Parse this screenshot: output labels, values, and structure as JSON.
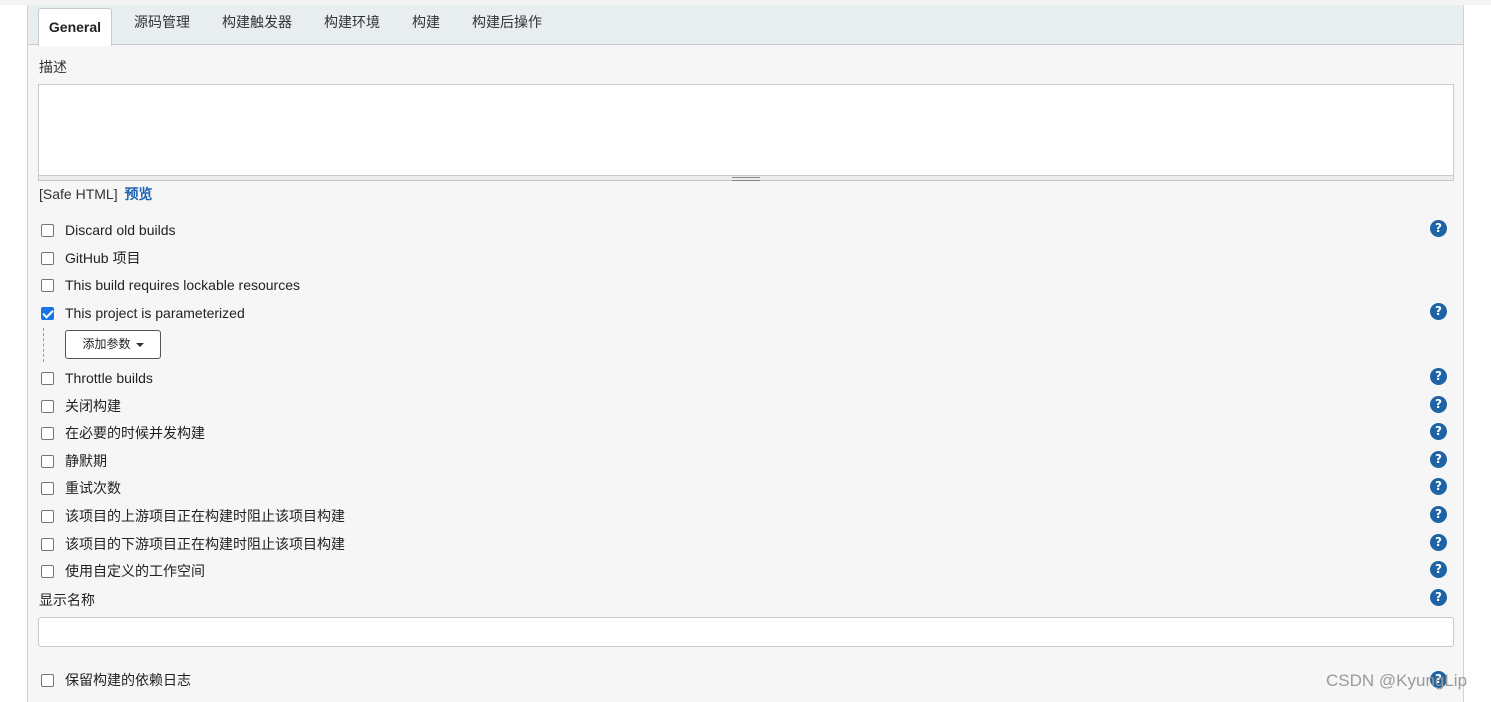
{
  "tabs": [
    "General",
    "源码管理",
    "构建触发器",
    "构建环境",
    "构建",
    "构建后操作"
  ],
  "description": {
    "label": "描述",
    "value": "",
    "safe_html": "[Safe HTML]",
    "preview_link": "预览"
  },
  "options": [
    {
      "label": "Discard old builds",
      "checked": false,
      "help": true
    },
    {
      "label": "GitHub 项目",
      "checked": false,
      "help": false
    },
    {
      "label": "This build requires lockable resources",
      "checked": false,
      "help": false
    },
    {
      "label": "This project is parameterized",
      "checked": true,
      "help": true
    },
    {
      "label": "Throttle builds",
      "checked": false,
      "help": true
    },
    {
      "label": "关闭构建",
      "checked": false,
      "help": true
    },
    {
      "label": "在必要的时候并发构建",
      "checked": false,
      "help": true
    },
    {
      "label": "静默期",
      "checked": false,
      "help": true
    },
    {
      "label": "重试次数",
      "checked": false,
      "help": true
    },
    {
      "label": "该项目的上游项目正在构建时阻止该项目构建",
      "checked": false,
      "help": true
    },
    {
      "label": "该项目的下游项目正在构建时阻止该项目构建",
      "checked": false,
      "help": true
    },
    {
      "label": "使用自定义的工作空间",
      "checked": false,
      "help": true
    },
    {
      "label": "保留构建的依赖日志",
      "checked": false,
      "help": true
    }
  ],
  "add_param_button": "添加参数",
  "display_name": {
    "label": "显示名称",
    "value": ""
  },
  "help_glyph": "?",
  "watermark": "CSDN @KyungLip",
  "colors": {
    "help_icon": "#1e63a6",
    "link": "#1f64b3",
    "checkbox_checked": "#1a73e8"
  }
}
